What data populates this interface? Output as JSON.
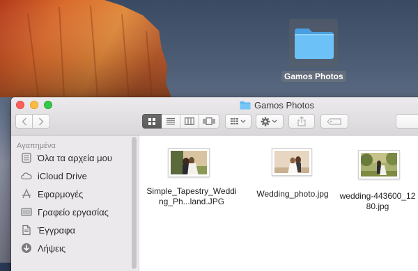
{
  "desktop": {
    "folder_label": "Gamos Photos"
  },
  "window": {
    "title": "Gamos Photos",
    "toolbar": {
      "back_icon": "chevron-left",
      "forward_icon": "chevron-right",
      "view_modes": [
        "icon-view",
        "list-view",
        "column-view",
        "cover-flow-view"
      ],
      "active_view": "icon-view",
      "arrange_icon": "grid-arrange",
      "action_icon": "gear",
      "share_icon": "share",
      "tags_icon": "tag"
    },
    "sidebar": {
      "heading": "Αγαπημένα",
      "items": [
        {
          "label": "Όλα τα αρχεία μου",
          "icon": "all-files-icon"
        },
        {
          "label": "iCloud Drive",
          "icon": "cloud-icon"
        },
        {
          "label": "Εφαρμογές",
          "icon": "applications-icon"
        },
        {
          "label": "Γραφείο εργασίας",
          "icon": "desktop-icon"
        },
        {
          "label": "Έγγραφα",
          "icon": "documents-icon"
        },
        {
          "label": "Λήψεις",
          "icon": "downloads-icon"
        }
      ]
    },
    "files": [
      {
        "name": "Simple_Tapestry_Wedding_Ph...land.JPG"
      },
      {
        "name": "Wedding_photo.jpg"
      },
      {
        "name": "wedding-443600_1280.jpg"
      }
    ]
  },
  "colors": {
    "accent": "#5bb5f0",
    "close": "#fc605c",
    "minimize": "#fdbc40",
    "maximize": "#34c84a"
  }
}
